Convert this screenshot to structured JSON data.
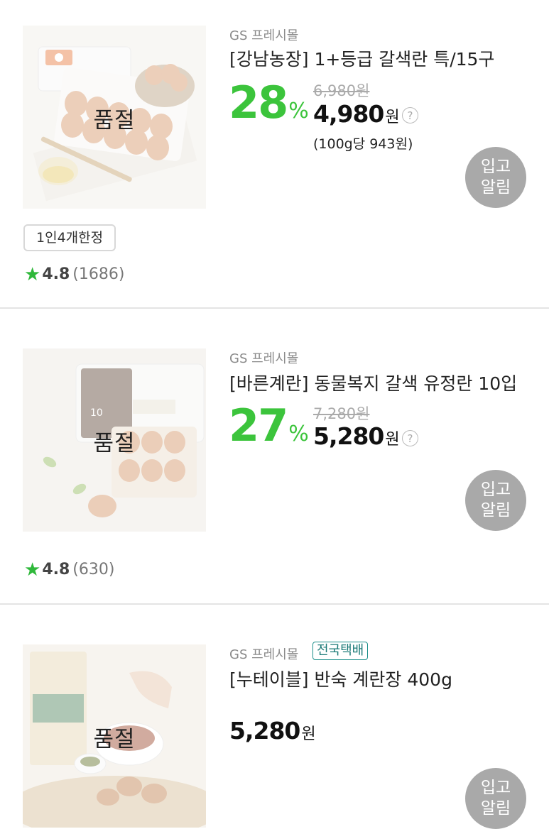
{
  "colors": {
    "discount_green": "#3cc43c",
    "star_green": "#2fb83a",
    "notify_gray": "#a9a9a9",
    "badge_teal": "#1b8f8a"
  },
  "products": [
    {
      "seller": "GS 프레시몰",
      "name": "[강남농장] 1+등급 갈색란 특/15구",
      "sold_out": "품절",
      "discount": "28",
      "discount_unit": "%",
      "original_price": "6,980원",
      "price": "4,980",
      "price_unit": "원",
      "help": "?",
      "unit_price": "(100g당 943원)",
      "notify_line1": "입고",
      "notify_line2": "알림",
      "limit_tag": "1인4개한정",
      "rating_score": "4.8",
      "rating_count": "(1686)",
      "image_icon": "egg-carton-image"
    },
    {
      "seller": "GS 프레시몰",
      "name": "[바른계란] 동물복지 갈색 유정란 10입",
      "sold_out": "품절",
      "discount": "27",
      "discount_unit": "%",
      "original_price": "7,280원",
      "price": "5,280",
      "price_unit": "원",
      "help": "?",
      "notify_line1": "입고",
      "notify_line2": "알림",
      "rating_score": "4.8",
      "rating_count": "(630)",
      "image_icon": "egg-pack-image"
    },
    {
      "seller": "GS 프레시몰",
      "badge": "전국택배",
      "name": "[누테이블] 반숙 계란장 400g",
      "sold_out": "품절",
      "price": "5,280",
      "price_unit": "원",
      "notify_line1": "입고",
      "notify_line2": "알림",
      "image_icon": "marinated-egg-image"
    }
  ]
}
